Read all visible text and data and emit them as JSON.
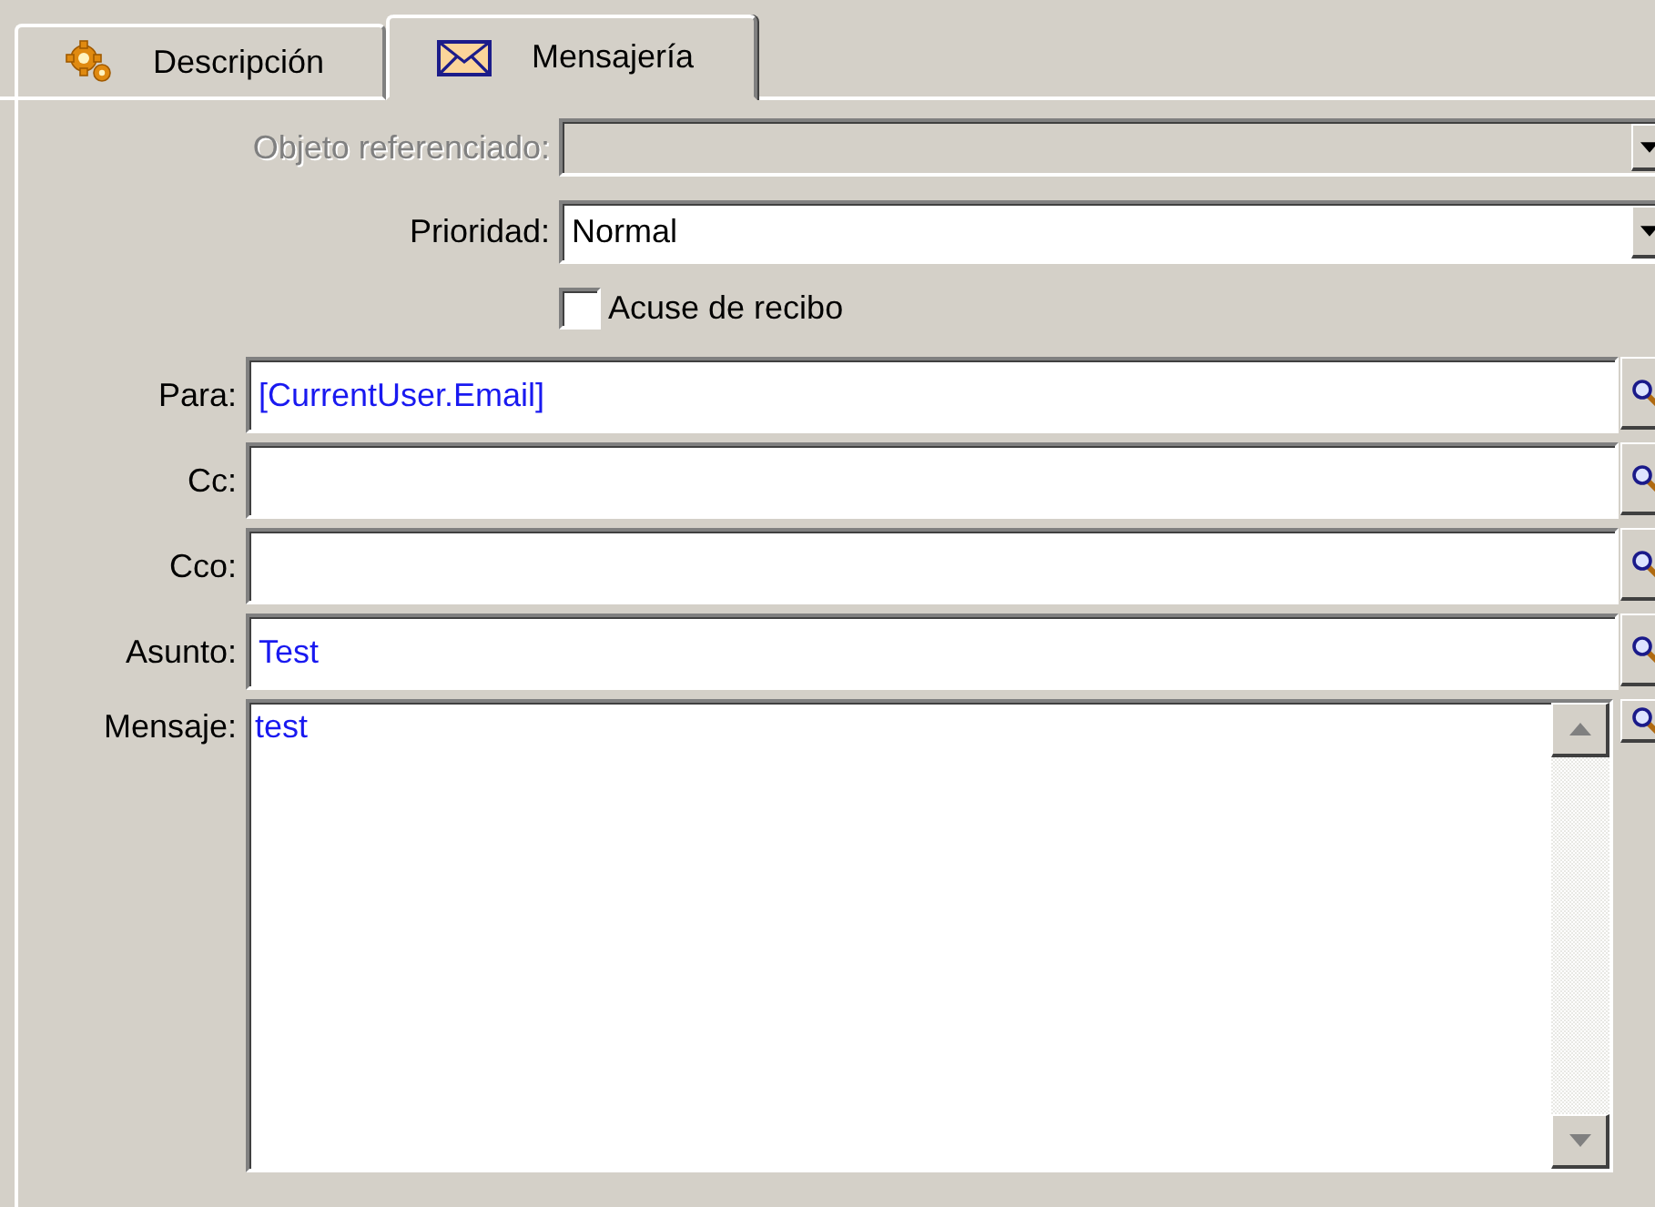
{
  "tabs": [
    {
      "label": "Descripción",
      "kind": "settings",
      "selected": false
    },
    {
      "label": "Mensajería",
      "kind": "mail",
      "selected": true
    }
  ],
  "header_fields": [
    {
      "kind": "combo",
      "label": "Objeto referenciado:",
      "disabled": true
    },
    {
      "kind": "combo",
      "label": "Prioridad:",
      "value": "Normal",
      "disabled": false
    },
    {
      "kind": "checkbox",
      "label": "Acuse de recibo",
      "checked": false
    }
  ],
  "address_fields": [
    {
      "kind": "lookup",
      "label": "Para:",
      "value": "[CurrentUser.Email]"
    },
    {
      "kind": "lookup",
      "label": "Cc:"
    },
    {
      "kind": "lookup",
      "label": "Cco:"
    },
    {
      "kind": "lookup",
      "label": "Asunto:",
      "value": "Test"
    },
    {
      "kind": "memo",
      "label": "Mensaje:",
      "value": "test"
    }
  ]
}
